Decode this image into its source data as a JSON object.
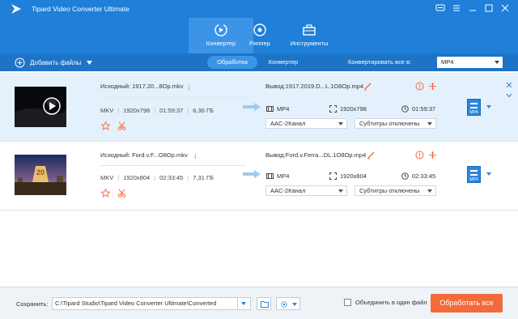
{
  "app": {
    "title": "Tipard Video Converter Ultimate",
    "accent_color": "#1f7fd9",
    "cta_color": "#f36a3b"
  },
  "main_tabs": [
    {
      "label": "Конвертер",
      "icon": "convert-icon",
      "active": true
    },
    {
      "label": "Риппер",
      "icon": "disc-icon",
      "active": false
    },
    {
      "label": "Инструменты",
      "icon": "toolbox-icon",
      "active": false
    }
  ],
  "toolbar": {
    "add_files_label": "Добавить файлы",
    "subtabs": [
      {
        "label": "Обработка",
        "active": true
      },
      {
        "label": "Конвертер",
        "active": false
      }
    ],
    "convert_all_to_label": "Конвертировать все в:",
    "convert_all_format": "MP4"
  },
  "files": [
    {
      "source": "Исходный: 1917.20...8Op.mkv",
      "format": "MKV",
      "resolution": "1920x798",
      "duration": "01:59:37",
      "size": "6,36 ГБ",
      "output": "Вывод:1917.2019.D...L.1O8Op.mp4",
      "out_format": "MP4",
      "out_resolution": "1920x798",
      "out_duration": "01:59:37",
      "audio": "AAC-2Канал",
      "subtitles": "Субтитры отключены",
      "badge": "MP4"
    },
    {
      "source": "Исходный: Ford.v.F...O8Op.mkv",
      "format": "MKV",
      "resolution": "1920x804",
      "duration": "02:33:45",
      "size": "7,31 ГБ",
      "output": "Вывод:Ford.v.Ferra...DL.1O8Op.mp4",
      "out_format": "MP4",
      "out_resolution": "1920x804",
      "out_duration": "02:33:45",
      "audio": "AAC-2Канал",
      "subtitles": "Субтитры отключены",
      "badge": "MP4"
    }
  ],
  "footer": {
    "save_label": "Сохранить:",
    "save_path": "C:\\Tipard Studio\\Tipard Video Converter Ultimate\\Converted",
    "merge_label": "Объединить в один файл",
    "convert_all_button": "Обработать все"
  }
}
